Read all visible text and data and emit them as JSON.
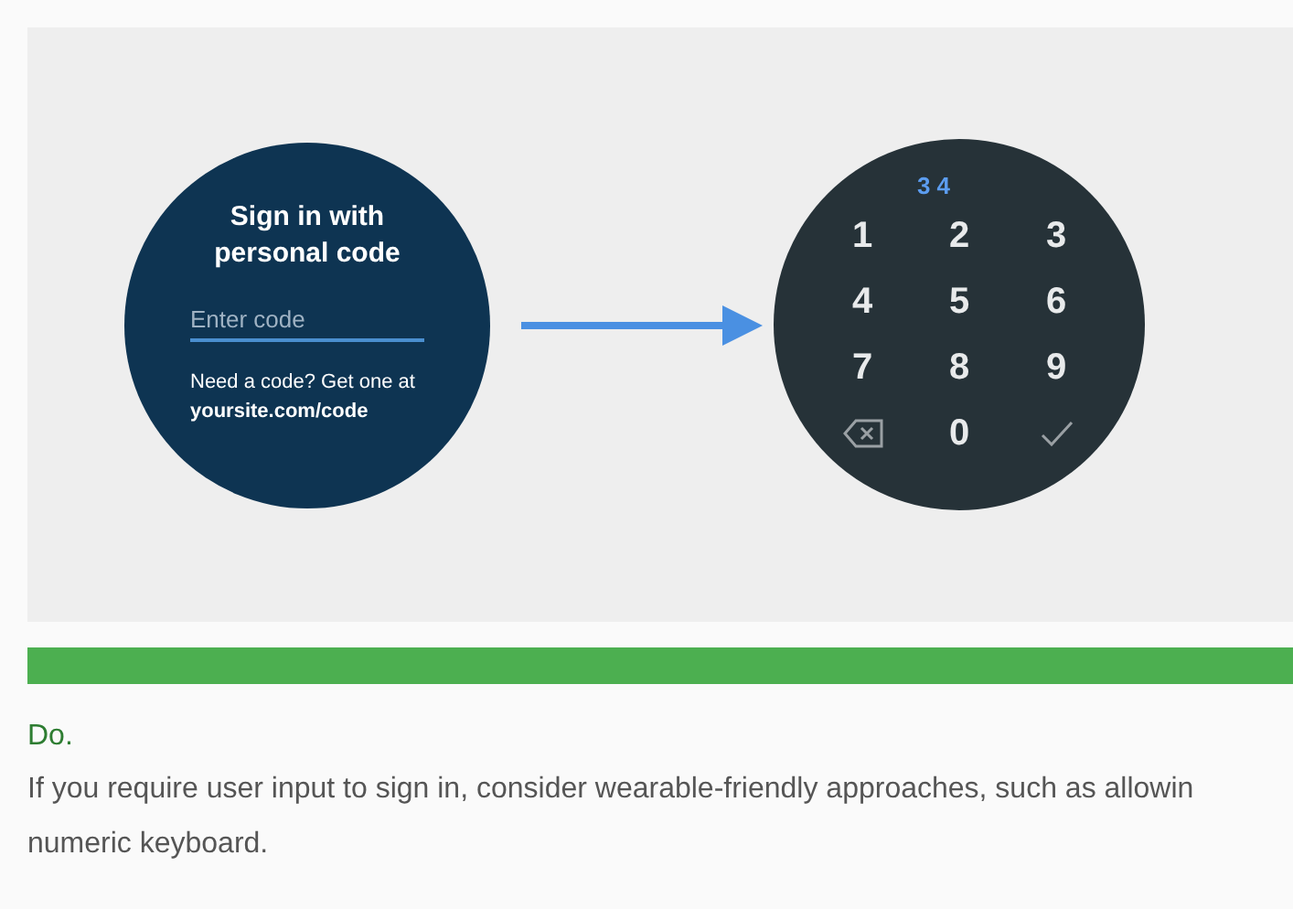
{
  "illustration": {
    "sign_in_screen": {
      "title": "Sign in with personal code",
      "code_field": {
        "placeholder": "Enter code"
      },
      "help_text": "Need a code? Get one at **yoursite.com/code**"
    },
    "keypad_screen": {
      "entered_code": "3 4",
      "keys": [
        {
          "kind": "digit",
          "label": "1"
        },
        {
          "kind": "digit",
          "label": "2"
        },
        {
          "kind": "digit",
          "label": "3"
        },
        {
          "kind": "digit",
          "label": "4"
        },
        {
          "kind": "digit",
          "label": "5"
        },
        {
          "kind": "digit",
          "label": "6"
        },
        {
          "kind": "digit",
          "label": "7"
        },
        {
          "kind": "digit",
          "label": "8"
        },
        {
          "kind": "digit",
          "label": "9"
        },
        {
          "kind": "backspace"
        },
        {
          "kind": "digit",
          "label": "0"
        },
        {
          "kind": "confirm"
        }
      ]
    }
  },
  "verdict": {
    "label": "Do.",
    "lines": [
      "If you require user input to sign in, consider wearable-friendly approaches, such as allowin",
      "numeric keyboard."
    ]
  }
}
